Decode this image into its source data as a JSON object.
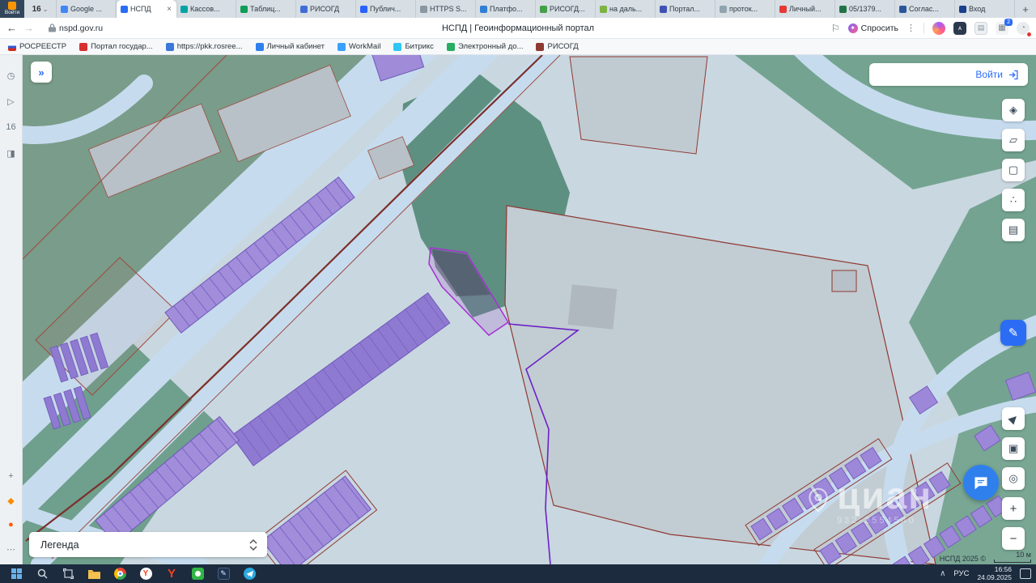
{
  "colors": {
    "accent": "#2b6cf5",
    "taskbar_bg": "#1c2b3e",
    "map_bg": "#c9d7e0",
    "map_green": "#74a491",
    "map_forest": "#5d9080",
    "map_road": "#c6dcee",
    "building_purple": "#a18dda",
    "parcel_line": "#8f3a32",
    "selected_outline": "#a82fd4",
    "boundary_purple": "#6b21c8"
  },
  "browser": {
    "profile_label": "Войти",
    "tab_counter": "16",
    "counter_chevron": "⌄",
    "close_glyph": "×",
    "new_tab_label": "+",
    "tabs": [
      {
        "label": "Google ...",
        "color": "#4285F4"
      },
      {
        "label": "НСПД",
        "color": "#2b6cf5",
        "active": true
      },
      {
        "label": "Кассов...",
        "color": "#00a3a3"
      },
      {
        "label": "Таблиц...",
        "color": "#0f9d58"
      },
      {
        "label": "РИСОГД",
        "color": "#3f6cd6"
      },
      {
        "label": "Публич...",
        "color": "#2962ff"
      },
      {
        "label": "HTTPS S...",
        "color": "#8a97a0"
      },
      {
        "label": "Платфо...",
        "color": "#2f7fd6"
      },
      {
        "label": "РИСОГД...",
        "color": "#43a047"
      },
      {
        "label": "на даль...",
        "color": "#7cb342"
      },
      {
        "label": "Портал...",
        "color": "#3f51b5"
      },
      {
        "label": "проток...",
        "color": "#90a4ae"
      },
      {
        "label": "Личный...",
        "color": "#e53935"
      },
      {
        "label": "05/1379...",
        "color": "#217346"
      },
      {
        "label": "Соглас...",
        "color": "#2b579a"
      },
      {
        "label": "Вход",
        "color": "#1a3f8b"
      }
    ],
    "address": {
      "back_arrow": "←",
      "forward_arrow": "→",
      "url": "nspd.gov.ru",
      "page_title": "НСПД | Геоинформационный портал",
      "bookmark_flag": "⚐",
      "ask_sparkle": "✦",
      "ask_label": "Спросить",
      "menu_dots": "⋮",
      "extensions_badge": "2"
    },
    "bookmarks": [
      {
        "label": "РОСРЕЕСТР",
        "color": "linear-gradient(180deg,#ffffff 33%,#2d5bd7 33% 66%,#d52b1e 66%)"
      },
      {
        "label": "Портал государ...",
        "color": "#d63031"
      },
      {
        "label": "https://pkk.rosree...",
        "color": "#3b78d8"
      },
      {
        "label": "Личный кабинет",
        "color": "#2f80ed"
      },
      {
        "label": "WorkMail",
        "color": "#3aa0ff"
      },
      {
        "label": "Битрикс",
        "color": "#2fc6f6"
      },
      {
        "label": "Электронный до...",
        "color": "#27ae60"
      },
      {
        "label": "РИСОГД",
        "color": "#8d3a32"
      }
    ]
  },
  "sidebar": {
    "top": [
      {
        "name": "history-icon",
        "glyph": "◷"
      },
      {
        "name": "player-icon",
        "glyph": "▷"
      },
      {
        "name": "tabs-count",
        "glyph": "16"
      },
      {
        "name": "screenshot-icon",
        "glyph": "◨"
      }
    ],
    "bottom": [
      {
        "name": "add-panel-icon",
        "glyph": "+"
      },
      {
        "name": "services-icon",
        "glyph": "◆",
        "color": "#ff8a00"
      },
      {
        "name": "games-icon",
        "glyph": "●",
        "color": "#ff5c00"
      },
      {
        "name": "more-icon",
        "glyph": "⋯"
      }
    ]
  },
  "map": {
    "collapse_glyph": "»",
    "login_label": "Войти",
    "legend_label": "Легенда",
    "watermark": "циан",
    "watermark_number": "932-2554540",
    "attribution": "НСПД 2025 ©",
    "scale_label": "10 м",
    "toolbar": {
      "layers": "◈",
      "measure": "▱",
      "extent": "▢",
      "share": "∴",
      "print": "▤",
      "draw": "✎",
      "locate": "▶",
      "basemap": "▣",
      "search_area": "◎",
      "zoom_in": "+",
      "zoom_out": "−"
    }
  },
  "taskbar": {
    "yandex_letter": "Y",
    "crypto_glyph": "✎",
    "tray_chevron": "∧",
    "lang": "РУС",
    "time": "16:56",
    "date": "24.09.2025"
  }
}
